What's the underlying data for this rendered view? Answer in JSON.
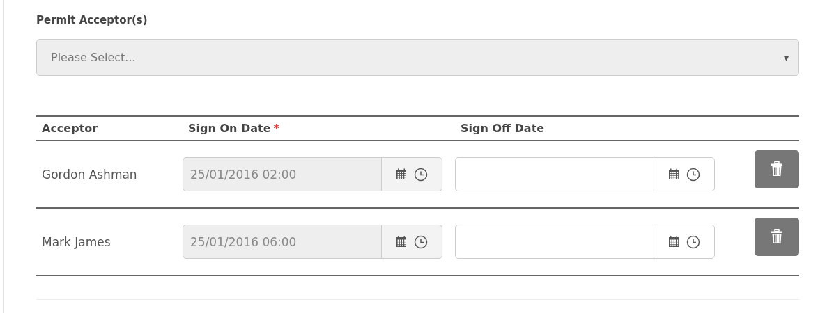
{
  "permit_acceptors": {
    "label": "Permit Acceptor(s)",
    "placeholder": "Please Select...",
    "caret": "▾"
  },
  "table": {
    "columns": [
      {
        "label": "Acceptor"
      },
      {
        "label": "Sign On Date",
        "required_mark": "*"
      },
      {
        "label": "Sign Off Date"
      }
    ],
    "rows": [
      {
        "acceptor": "Gordon Ashman",
        "sign_on": {
          "value": "25/01/2016 02:00",
          "disabled": true
        },
        "sign_off": {
          "disabled": false
        }
      },
      {
        "acceptor": "Mark James",
        "sign_on": {
          "value": "25/01/2016 06:00",
          "disabled": true
        },
        "sign_off": {
          "disabled": false
        }
      }
    ]
  }
}
